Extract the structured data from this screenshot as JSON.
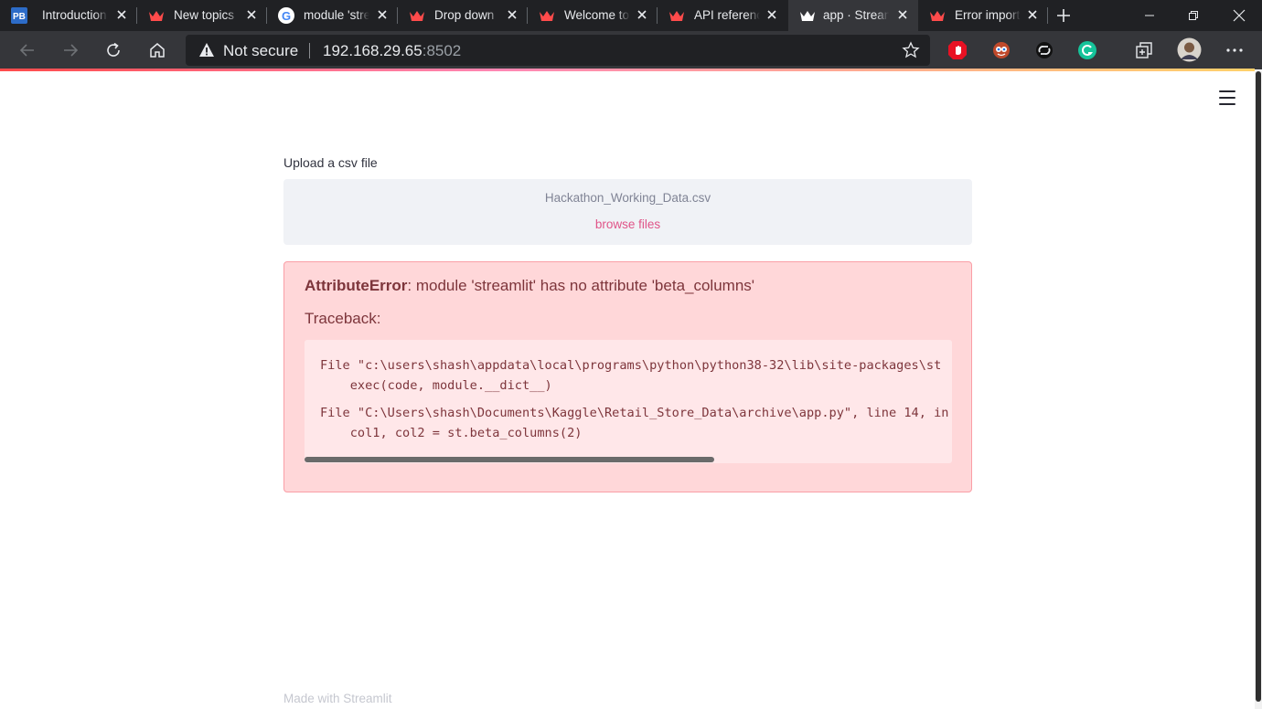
{
  "browser": {
    "tabs": [
      {
        "title": "Introduction",
        "favicon": "pb-logo-icon"
      },
      {
        "title": "New topics",
        "favicon": "streamlit-crown-icon"
      },
      {
        "title": "module 'stre",
        "favicon": "google-g-icon"
      },
      {
        "title": "Drop down",
        "favicon": "streamlit-crown-icon"
      },
      {
        "title": "Welcome to",
        "favicon": "streamlit-crown-icon"
      },
      {
        "title": "API referenc",
        "favicon": "streamlit-crown-icon"
      },
      {
        "title": "app · Stream",
        "favicon": "streamlit-crown-icon",
        "active": true
      },
      {
        "title": "Error import",
        "favicon": "streamlit-crown-icon"
      }
    ],
    "security_label": "Not secure",
    "url_host": "192.168.29.65",
    "url_port": ":8502",
    "colors": {
      "tab_bar": "#202124",
      "toolbar": "#35363a",
      "accent": "#ff4b4b"
    }
  },
  "app": {
    "uploader_label": "Upload a csv file",
    "uploaded_file": "Hackathon_Working_Data.csv",
    "browse_label": "browse files",
    "error": {
      "type": "AttributeError",
      "message": ": module 'streamlit' has no attribute 'beta_columns'",
      "traceback_label": "Traceback:",
      "lines": [
        "File \"c:\\users\\shash\\appdata\\local\\programs\\python\\python38-32\\lib\\site-packages\\st",
        "    exec(code, module.__dict__)",
        "File \"C:\\Users\\shash\\Documents\\Kaggle\\Retail_Store_Data\\archive\\app.py\", line 14, in",
        "    col1, col2 = st.beta_columns(2)"
      ]
    },
    "footer": "Made with Streamlit"
  }
}
